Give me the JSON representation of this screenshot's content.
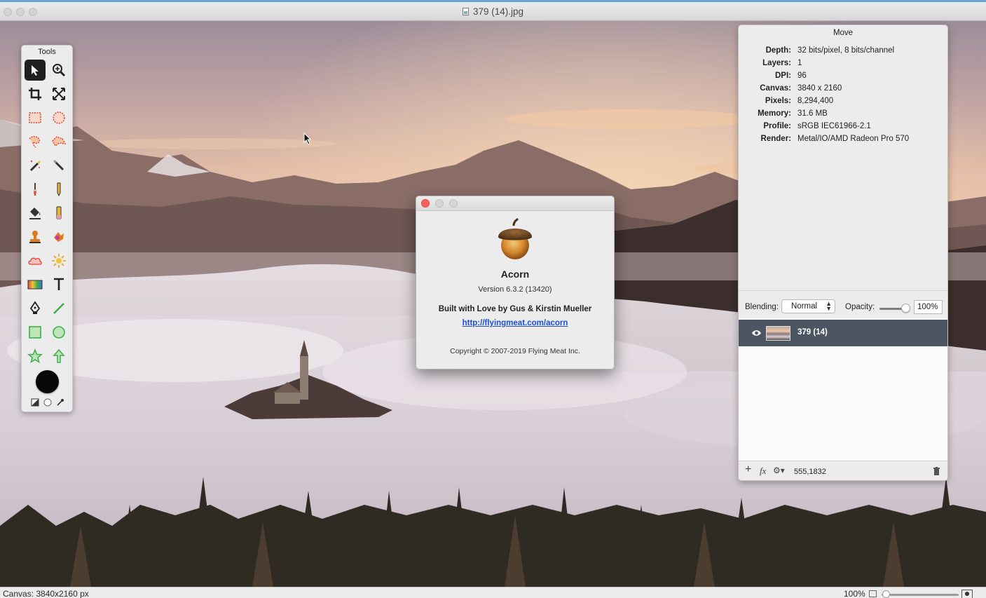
{
  "window": {
    "title": "379 (14).jpg",
    "status_canvas": "Canvas: 3840x2160 px",
    "zoom": "100%"
  },
  "tools": {
    "title": "Tools",
    "items": [
      {
        "name": "move-tool-icon",
        "active": true
      },
      {
        "name": "zoom-tool-icon"
      },
      {
        "name": "crop-tool-icon"
      },
      {
        "name": "transform-tool-icon"
      },
      {
        "name": "rect-select-tool-icon"
      },
      {
        "name": "oval-select-tool-icon"
      },
      {
        "name": "lasso-tool-icon"
      },
      {
        "name": "polygon-lasso-tool-icon"
      },
      {
        "name": "magic-wand-tool-icon"
      },
      {
        "name": "instant-alpha-tool-icon"
      },
      {
        "name": "brush-tool-icon"
      },
      {
        "name": "pencil-tool-icon"
      },
      {
        "name": "fill-bucket-tool-icon"
      },
      {
        "name": "eraser-tool-icon"
      },
      {
        "name": "clone-stamp-tool-icon"
      },
      {
        "name": "smudge-tool-icon"
      },
      {
        "name": "cloud-tool-icon"
      },
      {
        "name": "sun-burn-tool-icon"
      },
      {
        "name": "gradient-tool-icon"
      },
      {
        "name": "text-tool-icon"
      },
      {
        "name": "bezier-pen-tool-icon"
      },
      {
        "name": "line-tool-icon"
      },
      {
        "name": "rectangle-shape-tool-icon"
      },
      {
        "name": "oval-shape-tool-icon"
      },
      {
        "name": "star-tool-icon"
      },
      {
        "name": "arrow-tool-icon"
      }
    ],
    "foreground_color": "#080808"
  },
  "about": {
    "app_name": "Acorn",
    "version": "Version 6.3.2 (13420)",
    "built_with": "Built with Love by Gus & Kirstin Mueller",
    "link": "http://flyingmeat.com/acorn",
    "copyright": "Copyright © 2007-2019 Flying Meat Inc."
  },
  "inspector": {
    "title": "Move",
    "info": [
      {
        "label": "Depth:",
        "value": "32 bits/pixel, 8 bits/channel"
      },
      {
        "label": "Layers:",
        "value": "1"
      },
      {
        "label": "DPI:",
        "value": "96"
      },
      {
        "label": "Canvas:",
        "value": "3840 x 2160"
      },
      {
        "label": "Pixels:",
        "value": "8,294,400"
      },
      {
        "label": "Memory:",
        "value": "31.6 MB"
      },
      {
        "label": "Profile:",
        "value": "sRGB IEC61966-2.1"
      },
      {
        "label": "Render:",
        "value": "Metal/IO/AMD Radeon Pro 570"
      }
    ],
    "blending_label": "Blending:",
    "blending_value": "Normal",
    "opacity_label": "Opacity:",
    "opacity_value": "100%",
    "opacity_level": 1.0,
    "layers": [
      {
        "name": "379 (14)",
        "visible": true,
        "selected": true
      }
    ],
    "footer": {
      "add": "+",
      "fx": "fx",
      "gear": "⚙▾",
      "coords": "555,1832"
    }
  },
  "colors": {
    "selection_row": "#4c5662",
    "link": "#1a4fd8",
    "close_red": "#fc605c"
  }
}
